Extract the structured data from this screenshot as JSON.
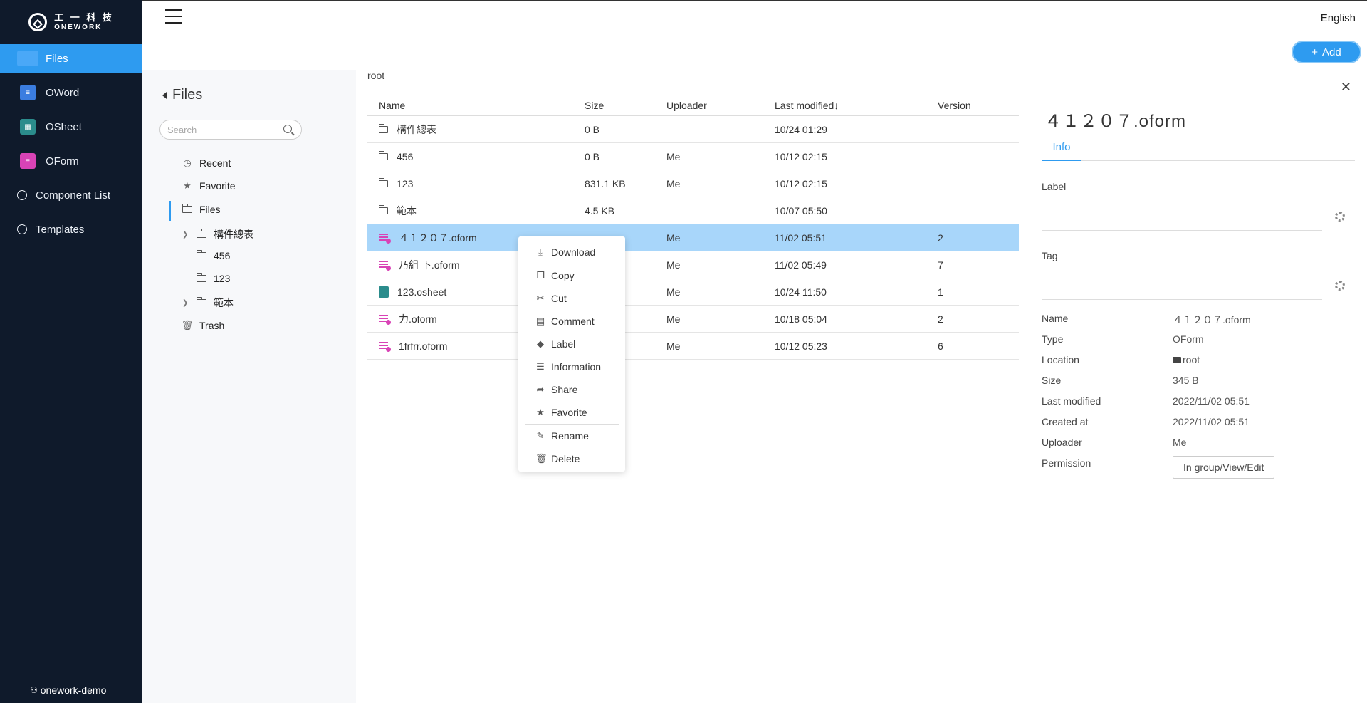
{
  "brand": {
    "cn": "工 一 科 技",
    "en": "ONEWORK"
  },
  "sidebar": {
    "items": [
      {
        "label": "Files",
        "icon": "folder-icon"
      },
      {
        "label": "OWord",
        "icon": "oword-icon"
      },
      {
        "label": "OSheet",
        "icon": "osheet-icon"
      },
      {
        "label": "OForm",
        "icon": "oform-icon"
      },
      {
        "label": "Component List",
        "icon": "pie-icon"
      },
      {
        "label": "Templates",
        "icon": "pie-icon"
      }
    ],
    "user": "onework-demo"
  },
  "header": {
    "language": "English",
    "add_label": "Add"
  },
  "tree": {
    "title": "Files",
    "search_placeholder": "Search",
    "items": [
      {
        "label": "Recent"
      },
      {
        "label": "Favorite"
      },
      {
        "label": "Files"
      },
      {
        "label": "構件總表"
      },
      {
        "label": "456"
      },
      {
        "label": "123"
      },
      {
        "label": "範本"
      },
      {
        "label": "Trash"
      }
    ]
  },
  "main": {
    "breadcrumb": "root",
    "columns": {
      "name": "Name",
      "size": "Size",
      "uploader": "Uploader",
      "modified": "Last modified↓",
      "version": "Version"
    },
    "rows": [
      {
        "name": "構件總表",
        "size": "0 B",
        "uploader": "",
        "modified": "10/24 01:29",
        "version": "",
        "type": "folder"
      },
      {
        "name": "456",
        "size": "0 B",
        "uploader": "Me",
        "modified": "10/12 02:15",
        "version": "",
        "type": "folder"
      },
      {
        "name": "123",
        "size": "831.1 KB",
        "uploader": "Me",
        "modified": "10/12 02:15",
        "version": "",
        "type": "folder"
      },
      {
        "name": "範本",
        "size": "4.5 KB",
        "uploader": "",
        "modified": "10/07 05:50",
        "version": "",
        "type": "folder"
      },
      {
        "name": "４１２０７.oform",
        "size": "",
        "uploader": "Me",
        "modified": "11/02 05:51",
        "version": "2",
        "type": "oform",
        "selected": true
      },
      {
        "name": "乃組 下.oform",
        "size": "",
        "uploader": "Me",
        "modified": "11/02 05:49",
        "version": "7",
        "type": "oform"
      },
      {
        "name": "123.osheet",
        "size": "",
        "uploader": "Me",
        "modified": "10/24 11:50",
        "version": "1",
        "type": "osheet"
      },
      {
        "name": "力.oform",
        "size": "",
        "uploader": "Me",
        "modified": "10/18 05:04",
        "version": "2",
        "type": "oform"
      },
      {
        "name": "1frfrr.oform",
        "size": "",
        "uploader": "Me",
        "modified": "10/12 05:23",
        "version": "6",
        "type": "oform"
      }
    ]
  },
  "context_menu": {
    "items": [
      {
        "label": "Download",
        "icon": "download-icon"
      },
      {
        "label": "Copy",
        "icon": "copy-icon"
      },
      {
        "label": "Cut",
        "icon": "scissors-icon"
      },
      {
        "label": "Comment",
        "icon": "comment-icon"
      },
      {
        "label": "Label",
        "icon": "label-icon"
      },
      {
        "label": "Information",
        "icon": "info-list-icon"
      },
      {
        "label": "Share",
        "icon": "share-icon"
      },
      {
        "label": "Favorite",
        "icon": "star-icon"
      },
      {
        "label": "Rename",
        "icon": "rename-icon"
      },
      {
        "label": "Delete",
        "icon": "trash-icon"
      }
    ]
  },
  "detail": {
    "title": "４１２０７.oform",
    "tab": "Info",
    "label_field": "Label",
    "tag_field": "Tag",
    "props": [
      {
        "k": "Name",
        "v": "４１２０７.oform"
      },
      {
        "k": "Type",
        "v": "OForm"
      },
      {
        "k": "Location",
        "v": "root"
      },
      {
        "k": "Size",
        "v": "345 B"
      },
      {
        "k": "Last modified",
        "v": "2022/11/02 05:51"
      },
      {
        "k": "Created at",
        "v": "2022/11/02 05:51"
      },
      {
        "k": "Uploader",
        "v": "Me"
      },
      {
        "k": "Permission",
        "v": "In group/View/Edit"
      }
    ]
  },
  "colors": {
    "accent": "#2e9bf0",
    "sidebar_bg": "#0f1a2b",
    "selected_row": "#a8d6fa",
    "oform": "#d943b6"
  }
}
